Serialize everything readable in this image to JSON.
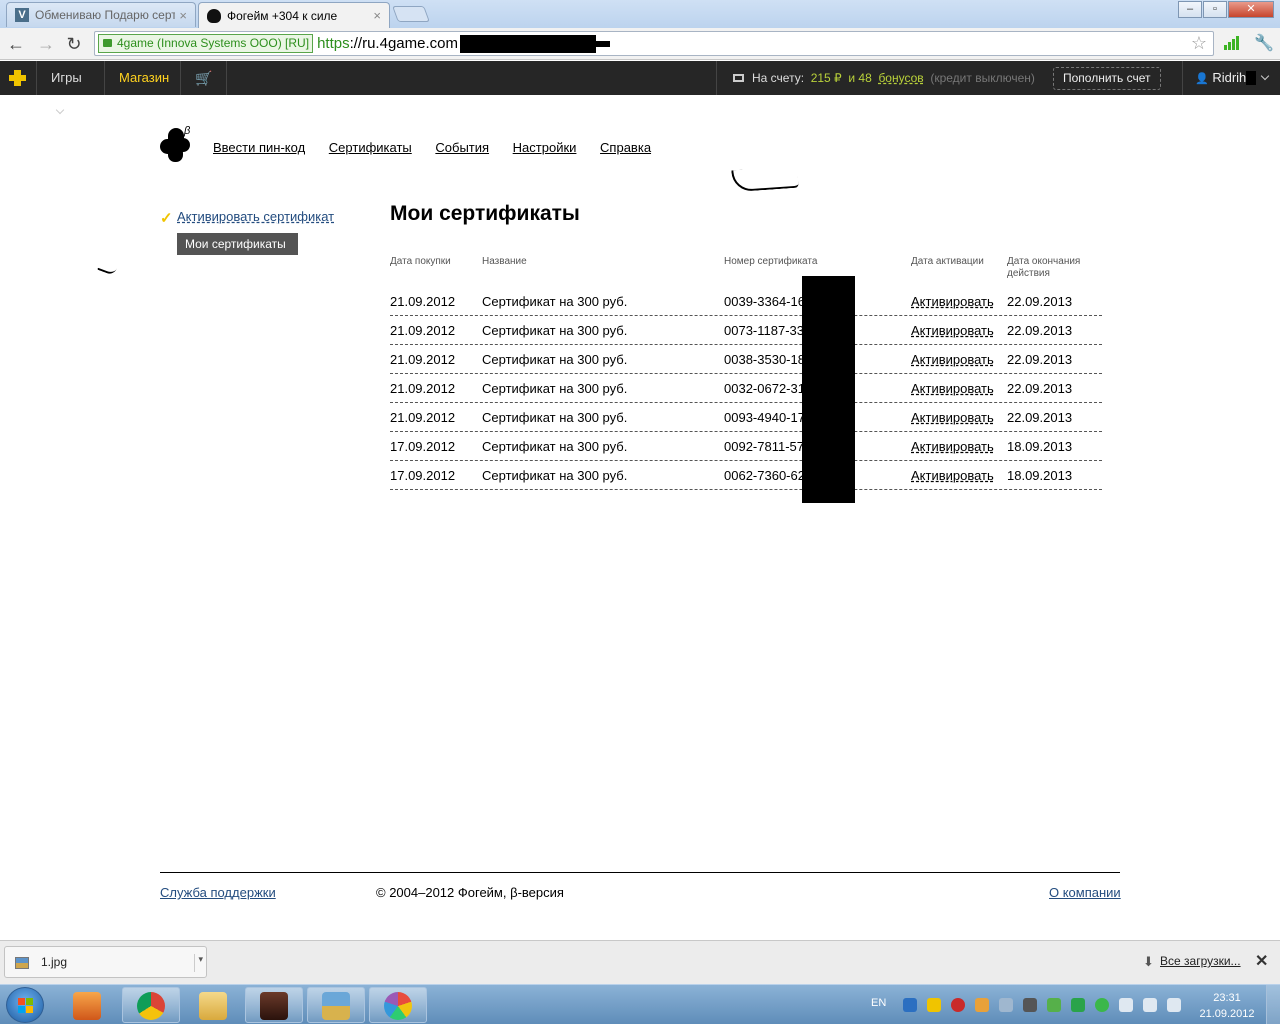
{
  "browser": {
    "tabs": [
      {
        "title": "Обмениваю Подарю серт",
        "active": false
      },
      {
        "title": "Фогейм +304 к силе",
        "active": true
      }
    ],
    "ev_label": "4game (Innova Systems OOO) [RU]",
    "url_scheme": "https",
    "url_rest": "://ru.4game.com"
  },
  "sitebar": {
    "games_label": "Игры",
    "shop_label": "Магазин",
    "balance_label": "На счету:",
    "balance_amount": "215 ₽",
    "balance_and": "и 48",
    "bonus_label": "бонусов",
    "credit_status": "(кредит выключен)",
    "topup_label": "Пополнить счет",
    "username": "Ridrih"
  },
  "brand": {
    "beta": "β"
  },
  "topnav": [
    "Ввести пин-код",
    "Сертификаты",
    "События",
    "Настройки",
    "Справка"
  ],
  "sidebar": {
    "activate_link": "Активировать сертификат",
    "active_item": "Мои сертификаты"
  },
  "main": {
    "title": "Мои сертификаты",
    "columns": [
      "Дата покупки",
      "Название",
      "Номер сертификата",
      "Дата активации",
      "Дата окончания действия"
    ],
    "rows": [
      {
        "date": "21.09.2012",
        "name": "Сертификат на 300 руб.",
        "number": "0039-3364-16",
        "action": "Активировать",
        "expires": "22.09.2013"
      },
      {
        "date": "21.09.2012",
        "name": "Сертификат на 300 руб.",
        "number": "0073-1187-33",
        "action": "Активировать",
        "expires": "22.09.2013"
      },
      {
        "date": "21.09.2012",
        "name": "Сертификат на 300 руб.",
        "number": "0038-3530-18",
        "action": "Активировать",
        "expires": "22.09.2013"
      },
      {
        "date": "21.09.2012",
        "name": "Сертификат на 300 руб.",
        "number": "0032-0672-31",
        "action": "Активировать",
        "expires": "22.09.2013"
      },
      {
        "date": "21.09.2012",
        "name": "Сертификат на 300 руб.",
        "number": "0093-4940-17",
        "action": "Активировать",
        "expires": "22.09.2013"
      },
      {
        "date": "17.09.2012",
        "name": "Сертификат на 300 руб.",
        "number": "0092-7811-57",
        "action": "Активировать",
        "expires": "18.09.2013"
      },
      {
        "date": "17.09.2012",
        "name": "Сертификат на 300 руб.",
        "number": "0062-7360-62",
        "action": "Активировать",
        "expires": "18.09.2013"
      }
    ]
  },
  "footer": {
    "support": "Служба поддержки",
    "copyright": "© 2004–2012 Фогейм, β-версия",
    "about": "О компании"
  },
  "downloads": {
    "file": "1.jpg",
    "all_label": "Все загрузки..."
  },
  "taskbar": {
    "lang": "EN",
    "time": "23:31",
    "date": "21.09.2012"
  },
  "colors": {
    "site_bar": "#262626",
    "shop_yellow": "#ffd21f",
    "balance_green": "#b9d13a",
    "link_blue": "#234c7f",
    "sidebar_active": "#545454"
  }
}
